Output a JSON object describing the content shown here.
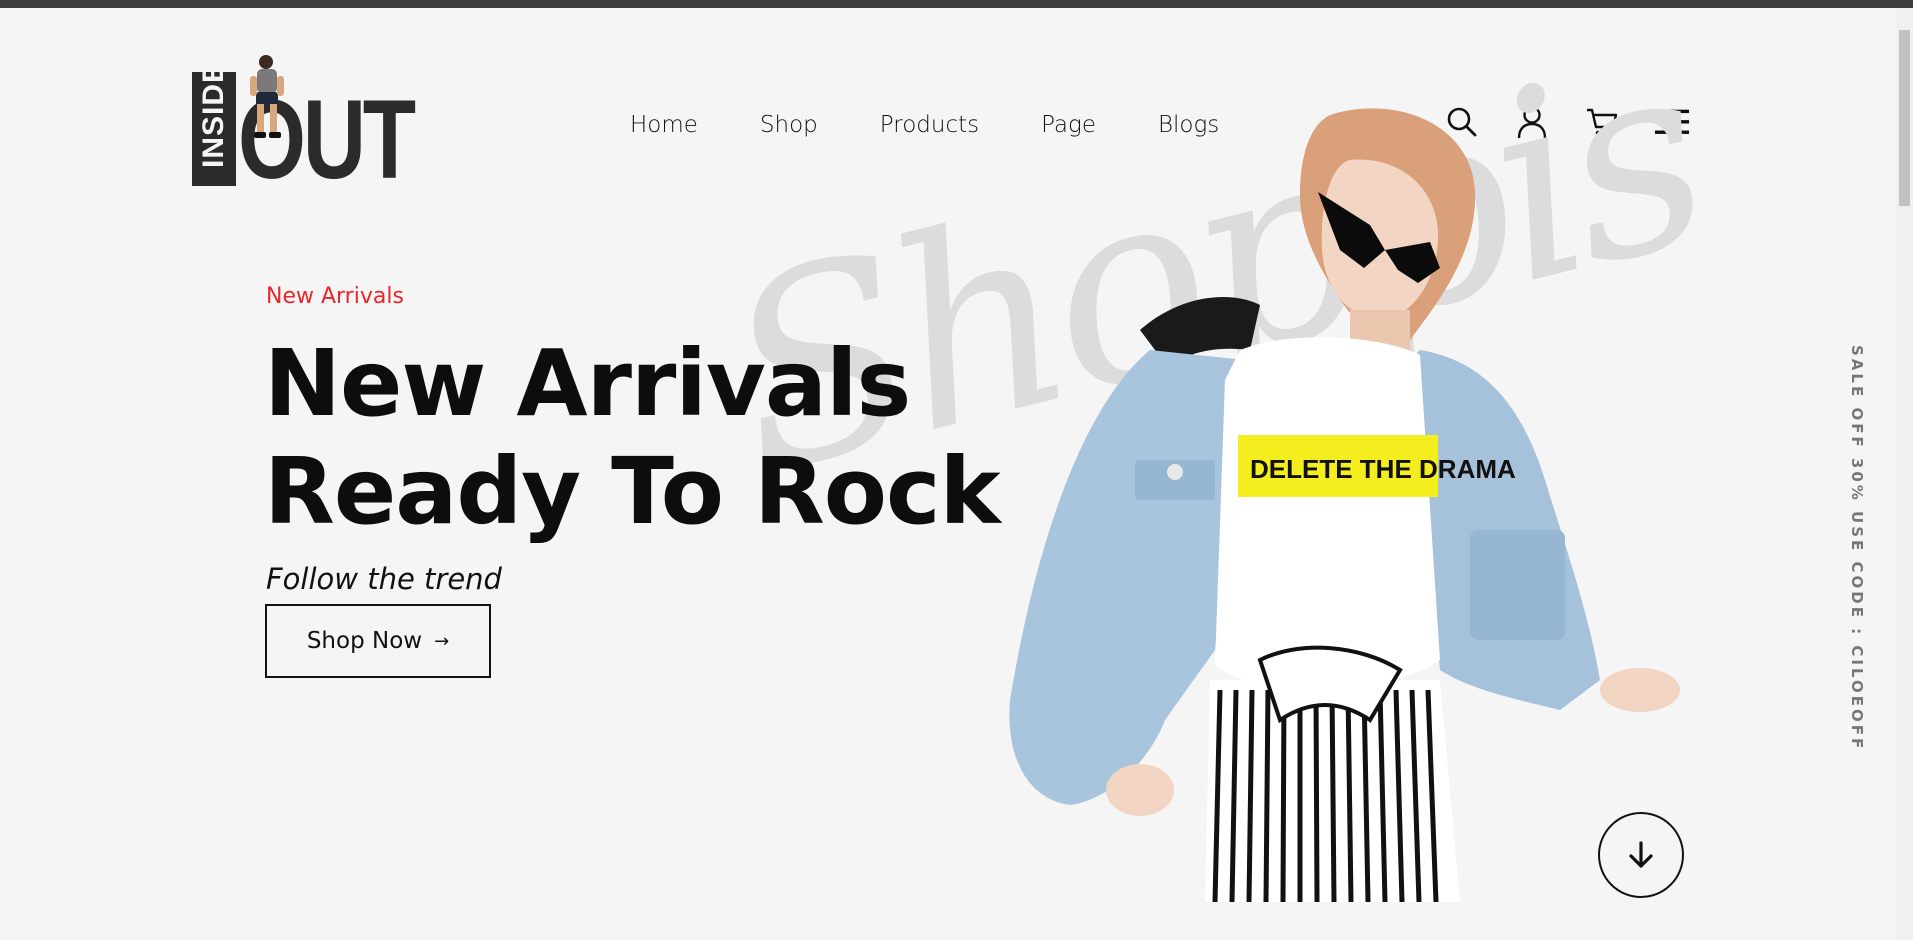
{
  "brand": {
    "logo_inside": "INSIDE",
    "logo_out": "OUT"
  },
  "nav": {
    "items": [
      "Home",
      "Shop",
      "Products",
      "Page",
      "Blogs"
    ]
  },
  "header_icons": [
    "search-icon",
    "user-icon",
    "cart-icon",
    "menu-icon"
  ],
  "hero": {
    "eyebrow": "New Arrivals",
    "headline_line1": "New Arrivals",
    "headline_line2": "Ready To Rock",
    "tagline": "Follow the trend",
    "cta_label": "Shop Now",
    "cta_arrow": "→",
    "watermark": "Shoppis",
    "shirt_text": "DELETE THE DRAMA"
  },
  "side_promo": "SALE OFF 30% USE CODE : CILOEOFF",
  "colors": {
    "accent": "#e8262b",
    "background": "#f5f5f5",
    "text": "#111111",
    "denim": "#a9c4dd",
    "highlight": "#f4ee1e"
  }
}
